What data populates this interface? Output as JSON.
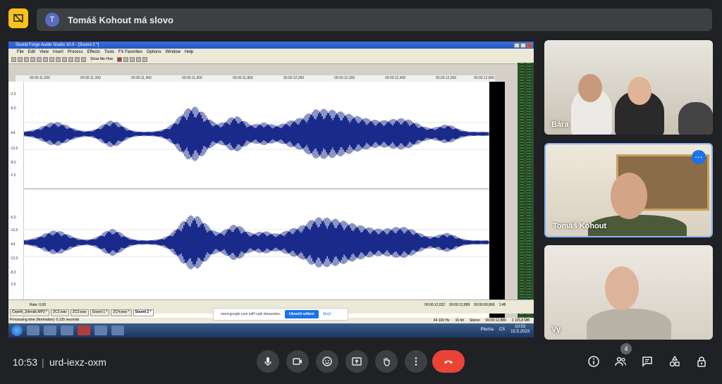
{
  "header": {
    "presenter_initial": "T",
    "presenter_text": "Tomáš Kohout má slovo"
  },
  "app": {
    "window_title": "Sound Forge Audio Studio 10.0 - [Sound 2 *]",
    "menu": [
      "File",
      "Edit",
      "View",
      "Insert",
      "Process",
      "Effects",
      "Tools",
      "FX Favorites",
      "Options",
      "Window",
      "Help"
    ],
    "show_me_how": "Show Me How",
    "ruler": [
      "00:00:11,000",
      "00:00:11,200",
      "00:00:11,400",
      "00:00:11,600",
      "00:00:11,800",
      "00:00:12,000",
      "00:00:12,200",
      "00:00:12,400",
      "00:00:12,600",
      "00:00:12,800"
    ],
    "scale": [
      "-2,5",
      "-6,0",
      "-Inf.",
      "-12,0",
      "-8,0",
      "-2,5",
      "-6,0",
      "-12,0",
      "-Inf.",
      "-12,0",
      "-8,0",
      "-2,5"
    ],
    "rate": "Rate: 0,00",
    "tabs": [
      "Čepelk_Zdenák.MP3 *",
      "ZC2.wav",
      "ZC3.wav",
      "Sound 1 *",
      "ZC4.wav *",
      "Sound 2 *"
    ],
    "status": "Processing time (Normalize): 0,125 seconds",
    "status_right": [
      "44 100 Hz",
      "16 bit",
      "Stereo",
      "00:00:12,889",
      "2 115,8 MB"
    ],
    "positions": [
      "00:00:12,022",
      "00:00:12,889",
      "00:00:00,866",
      "1:48"
    ]
  },
  "share_notice": {
    "text": "meet.google.com sdílí vaši obrazovku.",
    "stop": "Ukončit sdílení",
    "hide": "Skrýt"
  },
  "taskbar": {
    "label": "Plocha",
    "lang": "CS",
    "time": "10:53",
    "date": "15.5.2023"
  },
  "participants": [
    {
      "name": "Bára"
    },
    {
      "name": "Tomáš Kohout"
    },
    {
      "name": "Vy"
    }
  ],
  "bottom": {
    "time": "10:53",
    "separator": "|",
    "meeting_code": "urd-iexz-oxm",
    "people_count": "4"
  }
}
